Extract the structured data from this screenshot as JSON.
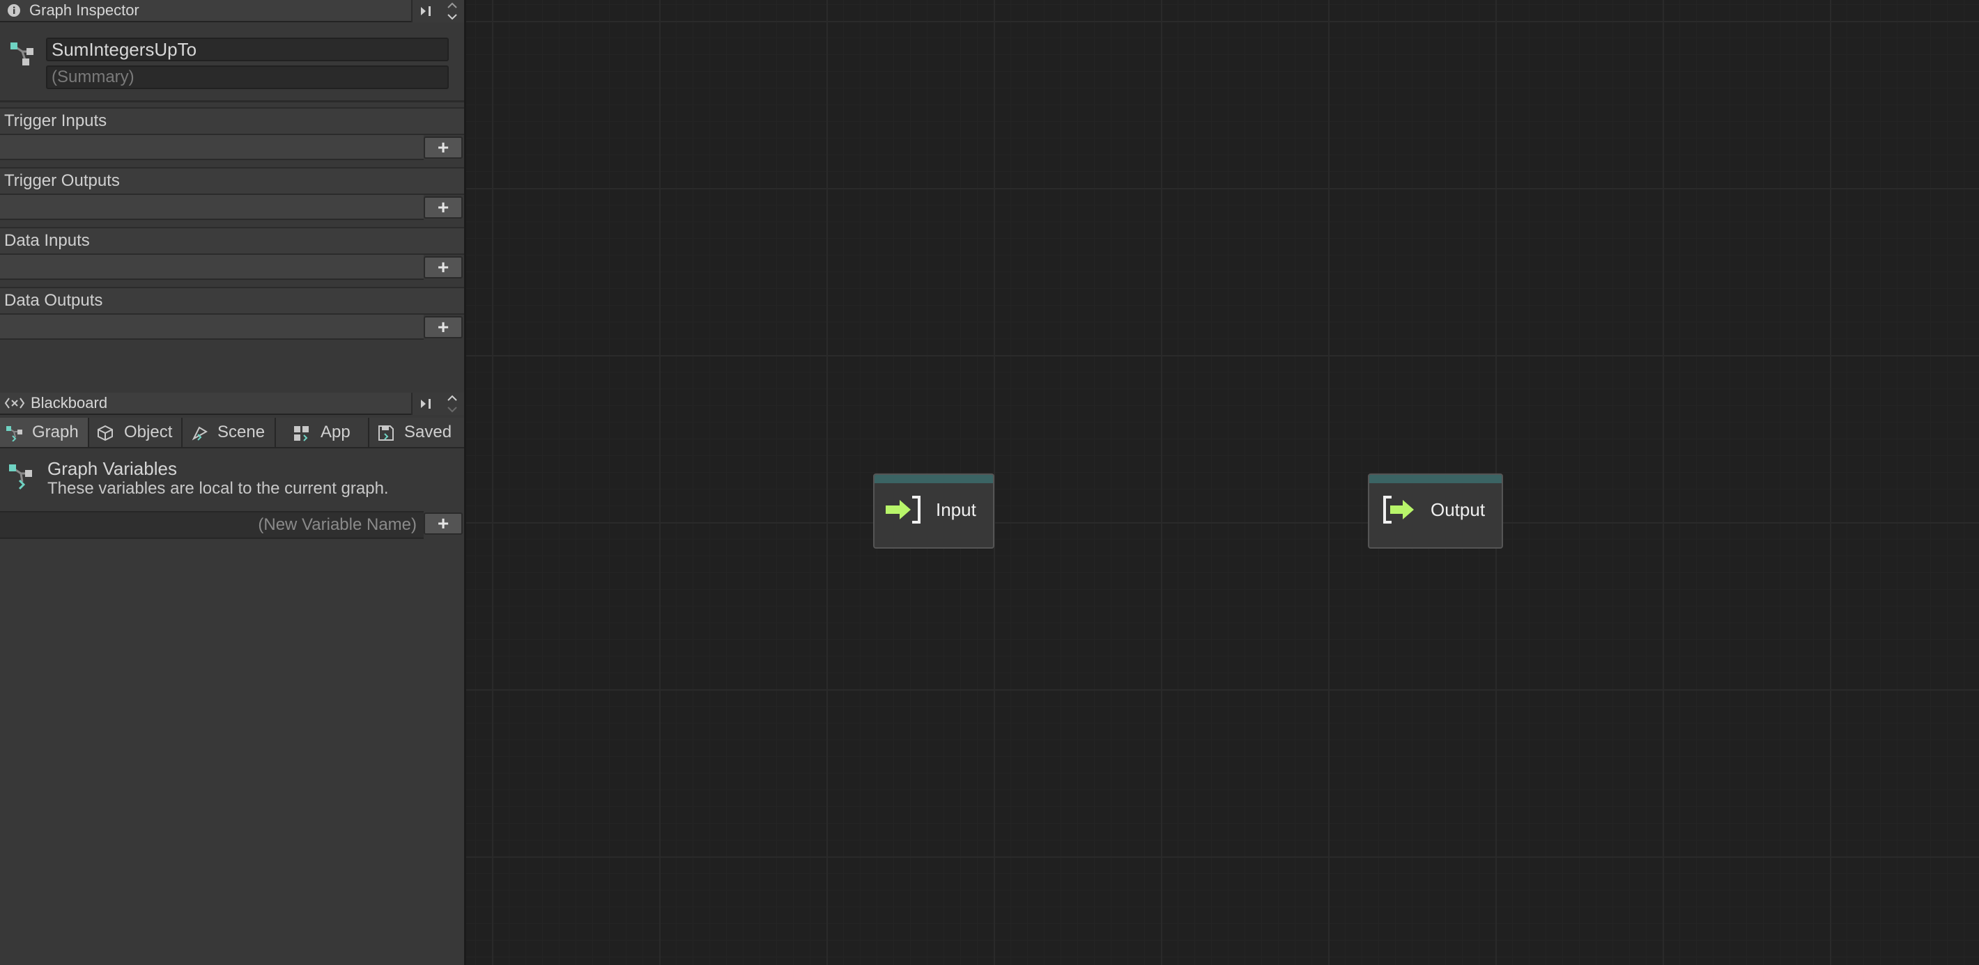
{
  "inspector": {
    "title": "Graph Inspector",
    "graph_name": "SumIntegersUpTo",
    "summary_placeholder": "(Summary)",
    "sections": [
      {
        "label": "Trigger Inputs",
        "add": "+"
      },
      {
        "label": "Trigger Outputs",
        "add": "+"
      },
      {
        "label": "Data Inputs",
        "add": "+"
      },
      {
        "label": "Data Outputs",
        "add": "+"
      }
    ]
  },
  "blackboard": {
    "title": "Blackboard",
    "tabs": [
      {
        "label": "Graph",
        "icon": "graph-icon",
        "active": true
      },
      {
        "label": "Object",
        "icon": "cube-icon"
      },
      {
        "label": "Scene",
        "icon": "scene-icon"
      },
      {
        "label": "App",
        "icon": "app-icon"
      },
      {
        "label": "Saved",
        "icon": "save-icon"
      }
    ],
    "section_title": "Graph Variables",
    "section_desc": "These variables are local to the current graph.",
    "new_variable_placeholder": "(New Variable Name)",
    "add": "+"
  },
  "canvas": {
    "nodes": [
      {
        "label": "Input",
        "icon": "input-arrow-icon"
      },
      {
        "label": "Output",
        "icon": "output-arrow-icon"
      }
    ]
  },
  "colors": {
    "node_header": "#3b6464",
    "arrow_green": "#b8f56a",
    "accent_teal": "#6fd3c3"
  }
}
